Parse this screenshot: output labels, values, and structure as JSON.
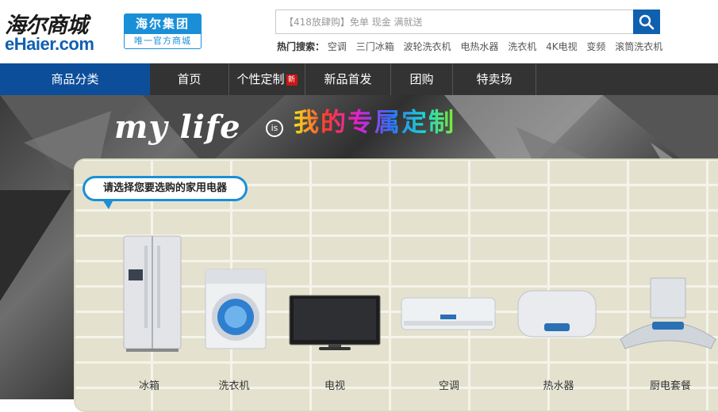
{
  "header": {
    "logo_cn": "海尔商城",
    "logo_en": "eHaier.com",
    "badge_top": "海尔集团",
    "badge_bottom": "唯一官方商城"
  },
  "search": {
    "placeholder": "【418放肆购】免单 现金 满就送",
    "hot_label": "热门搜索：",
    "hot_links": [
      "空调",
      "三门冰箱",
      "波轮洗衣机",
      "电热水器",
      "洗衣机",
      "4K电视",
      "变频",
      "滚筒洗衣机"
    ]
  },
  "nav": {
    "category": "商品分类",
    "items": [
      "首页",
      "个性定制",
      "新品首发",
      "团购",
      "特卖场"
    ],
    "new_badge": "新"
  },
  "banner": {
    "mylife": "my life",
    "is": "is",
    "slogan": "我的专属定制",
    "bubble": "请选择您要选购的家用电器",
    "products": [
      "冰箱",
      "洗衣机",
      "电视",
      "空调",
      "热水器",
      "厨电套餐"
    ]
  },
  "colors": {
    "brand_blue": "#1060b0",
    "nav_bg": "#333333",
    "nav_active": "#0d4e9b",
    "badge_blue": "#1a8fd8",
    "new_red": "#cc1515"
  }
}
